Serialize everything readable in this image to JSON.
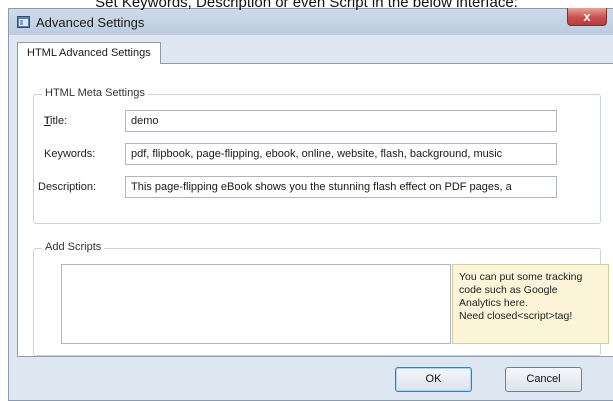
{
  "caption": "Set Keywords, Description or even Script in the below interface:",
  "window": {
    "title": "Advanced Settings",
    "close_symbol": "x",
    "app_icon": "application-icon"
  },
  "tabs": [
    {
      "label": "HTML Advanced Settings",
      "active": true
    }
  ],
  "meta": {
    "group_label": "HTML Meta Settings",
    "title_label": "Title:",
    "title_value": "demo",
    "keywords_label": "Keywords:",
    "keywords_value": "pdf, flipbook, page-flipping, ebook, online, website, flash, background, music",
    "description_label": "Description:",
    "description_value": "This page-flipping eBook shows you the stunning flash effect on PDF pages, a"
  },
  "scripts": {
    "group_label": "Add Scripts",
    "value": "",
    "tip_lines": [
      "You can put some tracking",
      "code such as Google",
      "Analytics here.",
      "Need closed<script>tag!"
    ]
  },
  "buttons": {
    "ok_label": "OK",
    "cancel_label": "Cancel"
  },
  "colors": {
    "window_bg": "#dde6f1",
    "close_button": "#c75050",
    "tip_bg": "#fbf4d8",
    "ok_focus_border": "#3c7fb1"
  }
}
